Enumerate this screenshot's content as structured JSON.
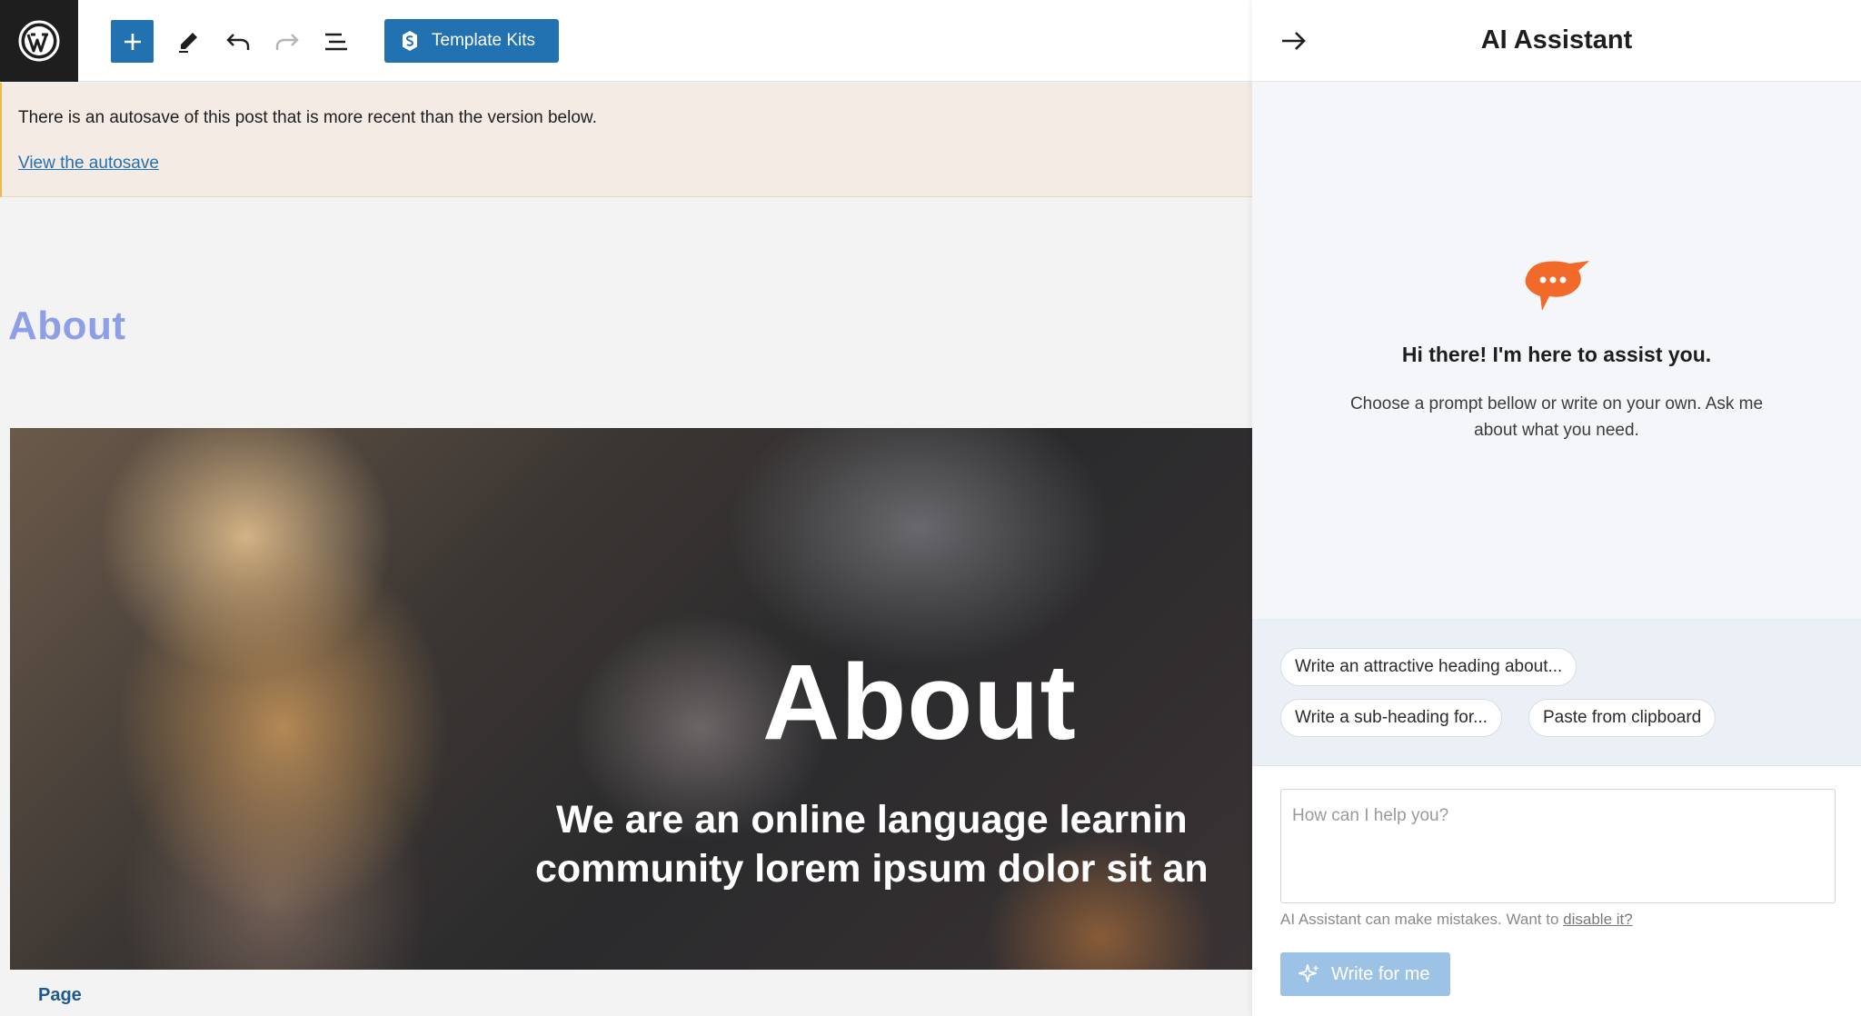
{
  "toolbar": {
    "template_kits_label": "Template Kits",
    "icons": [
      "wordpress-logo",
      "plus-icon",
      "pencil-icon",
      "undo-icon",
      "redo-icon",
      "list-view-icon",
      "template-kits-icon"
    ],
    "accent": "#2271b1"
  },
  "notice": {
    "message": "There is an autosave of this post that is more recent than the version below.",
    "link_label": "View the autosave"
  },
  "canvas": {
    "page_heading": "About",
    "hero_title": "About",
    "hero_subtitle_line1": "We are an online language learnin",
    "hero_subtitle_line2": "community lorem ipsum dolor sit an",
    "page_label": "Page"
  },
  "assistant": {
    "title": "AI Assistant",
    "greeting": "Hi there! I'm here to assist you.",
    "intro": "Choose a prompt bellow or write on your own. Ask me about what you need.",
    "prompts": [
      {
        "label": "Write an attractive heading about..."
      },
      {
        "label": "Write a sub-heading for..."
      },
      {
        "label": "Paste from clipboard"
      }
    ],
    "input_placeholder": "How can I help you?",
    "disclaimer_text": "AI Assistant can make mistakes. Want to ",
    "disclaimer_link": "disable it?",
    "write_button_label": "Write for me",
    "icon_color": "#f26a2a"
  }
}
